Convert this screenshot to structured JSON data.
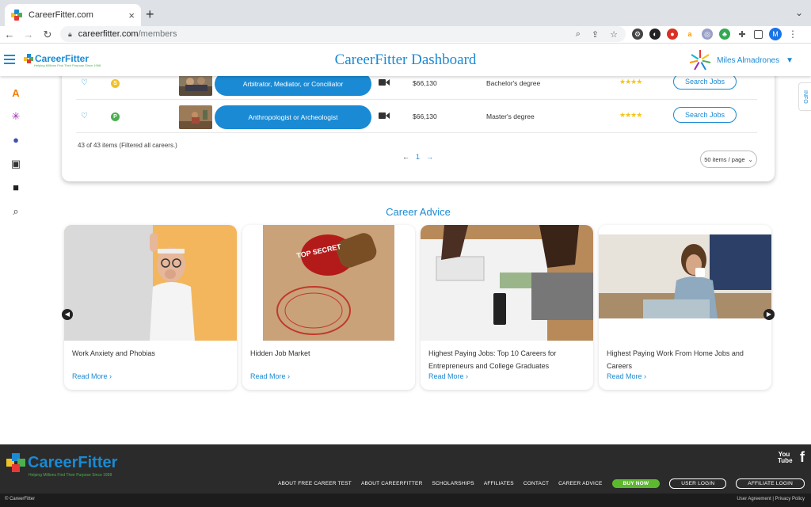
{
  "browser": {
    "tab_title": "CareerFitter.com",
    "tab_close": "×",
    "new_tab": "+",
    "url_host": "careerfitter.com",
    "url_path": "/members",
    "profile_initial": "M"
  },
  "header": {
    "title": "CareerFitter Dashboard",
    "logo_text": "CareerFitter",
    "logo_tagline": "Helping Millions Find Their Purpose Since 1998",
    "user_name": "Miles Almadrones"
  },
  "info_tab": "INFO",
  "careers": {
    "rows": [
      {
        "name": "Arbitrator, Mediator, or Conciliator",
        "badge": "S",
        "badge_color": "#f2c029",
        "salary": "$66,130",
        "degree": "Bachelor's degree",
        "stars": "★★★★",
        "action": "Search Jobs"
      },
      {
        "name": "Anthropologist or Archeologist",
        "badge": "P",
        "badge_color": "#4caf50",
        "salary": "$66,130",
        "degree": "Master's degree",
        "stars": "★★★★",
        "action": "Search Jobs"
      }
    ],
    "count_text": "43 of 43 items (Filtered all careers.)",
    "page": "1",
    "page_size": "50 items / page"
  },
  "advice": {
    "title": "Career Advice",
    "cards": [
      {
        "title": "Work Anxiety and Phobias",
        "more": "Read More ›"
      },
      {
        "title": "Hidden Job Market",
        "more": "Read More ›"
      },
      {
        "title": "Highest Paying Jobs: Top 10 Careers for Entrepreneurs and College Graduates",
        "more": "Read More ›"
      },
      {
        "title": "Highest Paying Work From Home Jobs and Careers",
        "more": "Read More ›"
      }
    ],
    "stamp_text": "TOP SECRET"
  },
  "footer": {
    "logo_text": "CareerFitter",
    "tagline": "Helping Millions Find Their Purpose Since 1998",
    "youtube": "You Tube",
    "facebook": "f",
    "nav": [
      "ABOUT FREE CAREER TEST",
      "ABOUT CAREERFITTER",
      "SCHOLARSHIPS",
      "AFFILIATES",
      "CONTACT",
      "CAREER ADVICE"
    ],
    "buy_now": "BUY NOW",
    "user_login": "USER LOGIN",
    "affiliate_login": "AFFILIATE LOGIN",
    "copyright": "© CareerFitter",
    "legal": "User Agreement | Privacy Policy"
  }
}
